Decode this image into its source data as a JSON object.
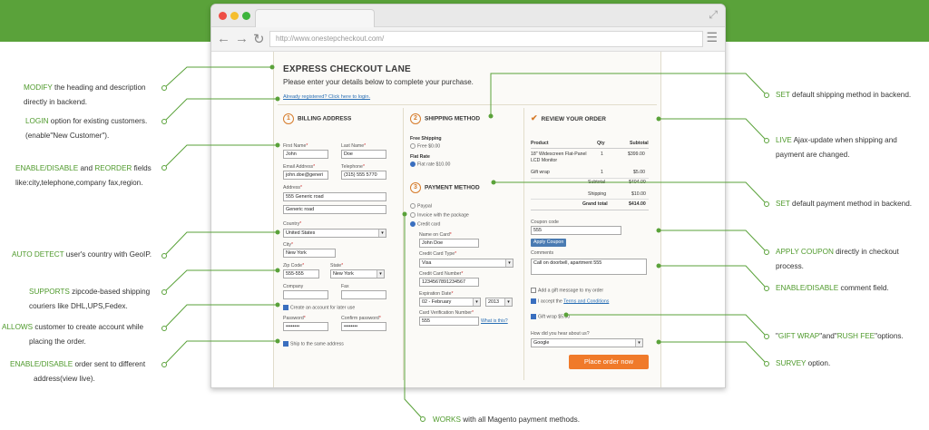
{
  "browser": {
    "url": "http://www.onestepcheckout.com/",
    "colors": {
      "close": "#ee4e46",
      "min": "#f5be2e",
      "max": "#3cb43c",
      "brand_green": "#5aa23a",
      "accent_orange": "#f07a2a"
    }
  },
  "page": {
    "heading": "EXPRESS CHECKOUT LANE",
    "description": "Please enter your details below to complete your purchase.",
    "login_link": "Already registered? Click here to login."
  },
  "billing": {
    "step": "1",
    "title": "BILLING ADDRESS",
    "first_name_label": "First Name",
    "first_name_value": "John",
    "last_name_label": "Last Name",
    "last_name_value": "Doe",
    "email_label": "Email Address",
    "email_value": "john.doe@generi",
    "telephone_label": "Telephone",
    "telephone_value": "(315) 555 5770",
    "address_label": "Address",
    "address1_value": "555 Generic road",
    "address2_value": "Generic road",
    "country_label": "Country",
    "country_value": "United States",
    "city_label": "City",
    "city_value": "New York",
    "zip_label": "Zip Code",
    "zip_value": "555-555",
    "state_label": "State",
    "state_value": "New York",
    "company_label": "Company",
    "fax_label": "Fax",
    "create_account_label": "Create an account for later use",
    "password_label": "Password",
    "password_value": "••••••••",
    "confirm_password_label": "Confirm password",
    "confirm_password_value": "••••••••",
    "ship_same_label": "Ship to the same address",
    "required_mark": "*"
  },
  "shipping": {
    "step": "2",
    "title": "SHIPPING METHOD",
    "group1": "Free Shipping",
    "option1": "Free $0.00",
    "group2": "Flat Rate",
    "option2": "Flat rate $10.00"
  },
  "payment": {
    "step": "3",
    "title": "PAYMENT METHOD",
    "option_paypal": "Paypal",
    "option_invoice": "Invoice with the package",
    "option_credit": "Credit card",
    "name_label": "Name on Card",
    "name_value": "John Doe",
    "type_label": "Credit Card Type",
    "type_value": "Visa",
    "number_label": "Credit Card Number",
    "number_value": "1234567891234567",
    "exp_label": "Expiration Date",
    "exp_month": "02 - February",
    "exp_year": "2013",
    "cvv_label": "Card Verification Number",
    "cvv_value": "555",
    "what_is_this": "What is this?"
  },
  "review": {
    "title": "REVIEW YOUR ORDER",
    "headers": [
      "Product",
      "Qty",
      "Subtotal"
    ],
    "rows": [
      {
        "product": "18\" Widescreen Flat-Panel",
        "product2": "LCD Monitor",
        "qty": "1",
        "subtotal": "$399.00"
      },
      {
        "product": "Gift wrap",
        "product2": "",
        "qty": "1",
        "subtotal": "$5.00"
      }
    ],
    "subtotal_label": "Subtotal",
    "subtotal_value": "$404.00",
    "shipping_label": "Shipping",
    "shipping_value": "$10.00",
    "grand_total_label": "Grand total",
    "grand_total_value": "$414.00",
    "coupon_label": "Coupon code",
    "coupon_value": "555",
    "apply_coupon": "Apply Coupon",
    "comments_label": "Comments",
    "comments_value": "Call on doorbell, apartment 555",
    "gift_message_label": "Add a gift message to my order",
    "terms_prefix": "I accept the ",
    "terms_link": "Terms and Conditions",
    "gift_wrap_label": "Gift wrap $5.00",
    "survey_label": "How did you hear about us?",
    "survey_value": "Google",
    "place_order": "Place order now"
  },
  "annotations": {
    "a1_key": "MODIFY",
    "a1_text": " the heading and description",
    "a1_line2": "directly in backend.",
    "a2_key": "LOGIN",
    "a2_text": " option for existing customers.",
    "a2_line2": "(enable\"New Customer\").",
    "a3_key": "ENABLE/DISABLE",
    "a3_mid": " and ",
    "a3_key2": "REORDER",
    "a3_text": " fields",
    "a3_line2": "like:city,telephone,company fax,region.",
    "a4_key": "AUTO DETECT",
    "a4_text": " user's country with GeoIP.",
    "a5_key": "SUPPORTS",
    "a5_text": " zipcode-based shipping",
    "a5_line2": "couriers like DHL,UPS,Fedex.",
    "a6_key": "ALLOWS",
    "a6_text": " customer to create account while",
    "a6_line2": "placing the order.",
    "a7_key": "ENABLE/DISABLE",
    "a7_text": " order sent to different",
    "a7_line2": "address(view live).",
    "a8_key": "WORKS",
    "a8_text": " with all Magento payment methods.",
    "b1_key": "SET",
    "b1_text": " default shipping method in backend.",
    "b2_key": "LIVE",
    "b2_text": " Ajax-update when shipping and",
    "b2_line2": "payment are changed.",
    "b3_key": "SET",
    "b3_text": " default payment method in backend.",
    "b4_key": "APPLY COUPON",
    "b4_text": " directly in checkout",
    "b4_line2": "process.",
    "b5_key": "ENABLE/DISABLE",
    "b5_text": " comment field.",
    "b6_q1": "\"",
    "b6_key": "GIFT WRAP",
    "b6_mid": "\"and\"",
    "b6_key2": "RUSH FEE",
    "b6_text": "\"options.",
    "b7_key": "SURVEY",
    "b7_text": " option."
  }
}
